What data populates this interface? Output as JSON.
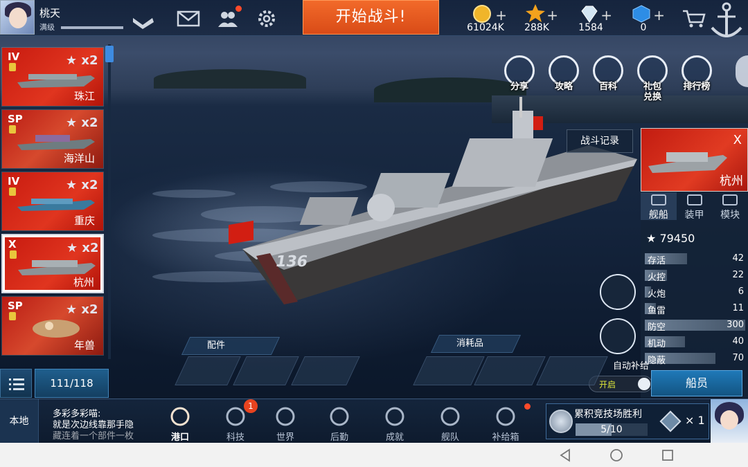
{
  "player": {
    "name": "桃天",
    "level_label": "满级",
    "exp_progress": 1.0
  },
  "topbar": {
    "start_battle": "开始战斗!",
    "resources": [
      {
        "icon": "gold-coin-icon",
        "value": "61024K"
      },
      {
        "icon": "star-icon",
        "value": "288K"
      },
      {
        "icon": "diamond-icon",
        "value": "1584"
      },
      {
        "icon": "cube-icon",
        "value": "0"
      }
    ]
  },
  "ship_list": {
    "cards": [
      {
        "tier": "IV",
        "multiplier": "x2",
        "name": "珠江"
      },
      {
        "tier": "SP",
        "multiplier": "x2",
        "name": "海洋山"
      },
      {
        "tier": "IV",
        "multiplier": "x2",
        "name": "重庆"
      },
      {
        "tier": "X",
        "multiplier": "x2",
        "name": "杭州"
      },
      {
        "tier": "SP",
        "multiplier": "x2",
        "name": "年兽"
      }
    ],
    "count": "111/118"
  },
  "functions": [
    {
      "label": "分享"
    },
    {
      "label": "攻略"
    },
    {
      "label": "百科"
    },
    {
      "label": "礼包兑换"
    },
    {
      "label": "排行榜"
    }
  ],
  "battle_record": "战斗记录",
  "ship_number": "136",
  "panel": {
    "tier": "X",
    "ship_name": "杭州",
    "tabs": [
      "舰船",
      "装甲",
      "模块"
    ],
    "power": "79450",
    "stats": [
      {
        "label": "存活",
        "value": "42",
        "fill": 0.42
      },
      {
        "label": "火控",
        "value": "22",
        "fill": 0.22
      },
      {
        "label": "火炮",
        "value": "6",
        "fill": 0.06
      },
      {
        "label": "鱼雷",
        "value": "11",
        "fill": 0.11
      },
      {
        "label": "防空",
        "value": "300",
        "fill": 1.0
      },
      {
        "label": "机动",
        "value": "40",
        "fill": 0.4
      },
      {
        "label": "隐蔽",
        "value": "70",
        "fill": 0.7
      }
    ],
    "crew_button": "船员"
  },
  "auto_supply": {
    "label": "自动补给",
    "state": "开启"
  },
  "equip": {
    "label": "配件"
  },
  "consumables": {
    "label": "消耗品"
  },
  "bottom": {
    "channel": "本地",
    "chat_lines": [
      "多彩多彩喵:",
      "就是次边线靠那手隐",
      "藏连着一个部件一枚"
    ],
    "nav": [
      {
        "label": "港口",
        "icon": "harbor-icon",
        "active": true
      },
      {
        "label": "科技",
        "icon": "tech-icon",
        "badge": "1"
      },
      {
        "label": "世界",
        "icon": "globe-icon"
      },
      {
        "label": "后勤",
        "icon": "logistics-icon"
      },
      {
        "label": "成就",
        "icon": "achievement-icon"
      },
      {
        "label": "舰队",
        "icon": "fleet-icon"
      },
      {
        "label": "补给箱",
        "icon": "supply-box-icon"
      }
    ],
    "arena": {
      "title": "累积竞技场胜利",
      "progress": "5/10",
      "fraction": 0.5,
      "reward_count": "× 1"
    }
  }
}
